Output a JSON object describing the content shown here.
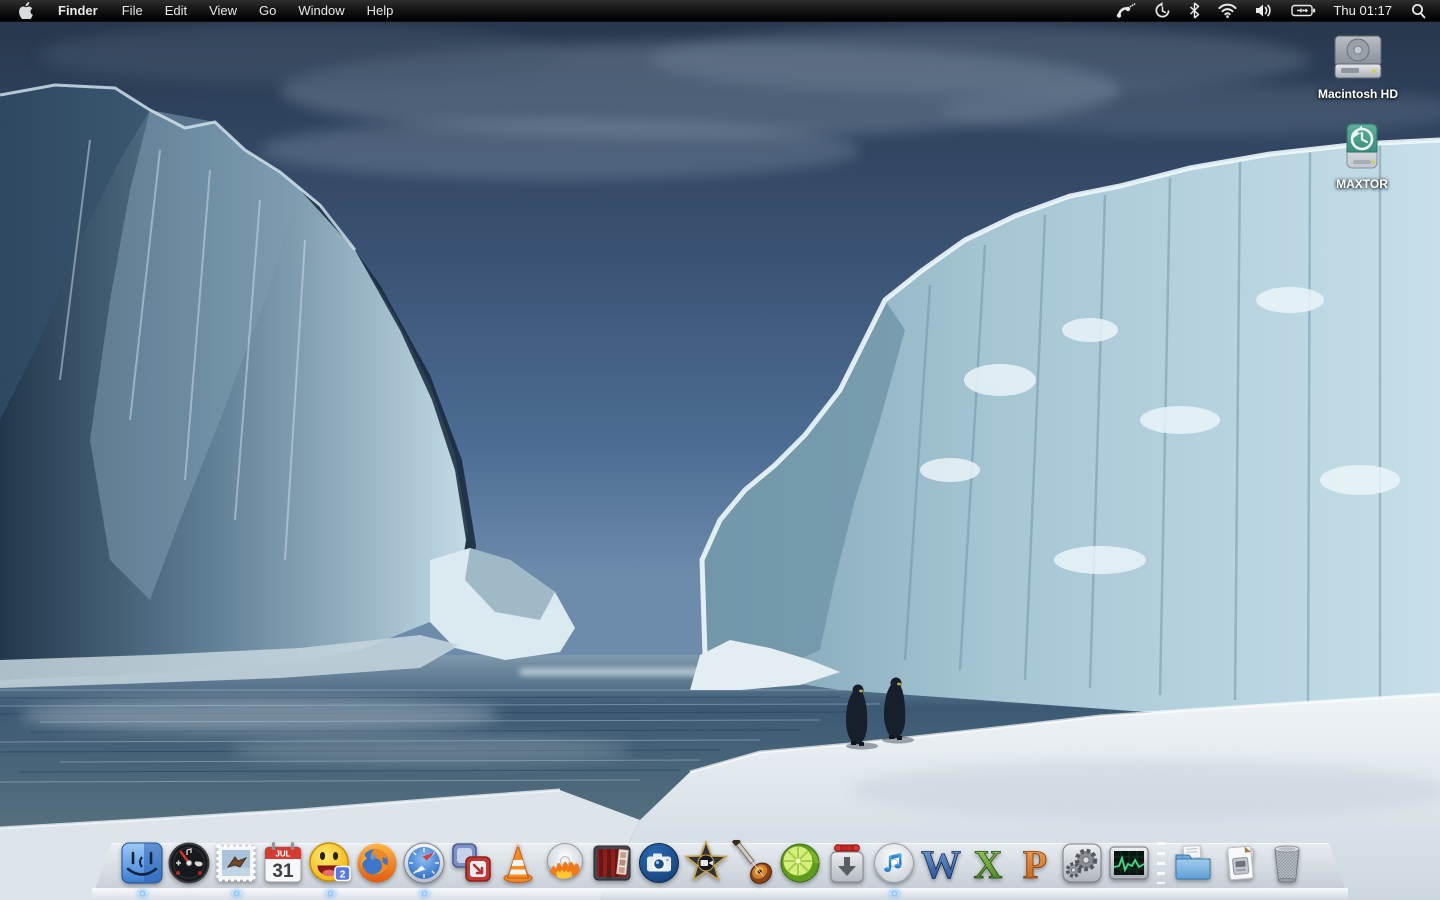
{
  "menu_bar": {
    "active_app": "Finder",
    "items": [
      "Finder",
      "File",
      "Edit",
      "View",
      "Go",
      "Window",
      "Help"
    ],
    "clock": "Thu 01:17",
    "status_icons": [
      "phone",
      "time-machine",
      "bluetooth",
      "wifi",
      "volume",
      "battery",
      "spotlight"
    ],
    "colors": {
      "bar_bg": "#000000",
      "text": "#e8e8e8"
    }
  },
  "desktop": {
    "volumes": [
      {
        "label": "Macintosh HD",
        "type": "internal-hard-drive"
      },
      {
        "label": "MAXTOR",
        "type": "external-time-machine-drive"
      }
    ],
    "wallpaper": {
      "subject": "iceberg canyon with two emperor penguins",
      "colors": {
        "sky_top": "#26354a",
        "sky_mid": "#49688c",
        "ice_light": "#c2dae4",
        "ice_dark": "#1c3046",
        "water": "#3c5a74",
        "snow": "#e8edf1"
      }
    }
  },
  "dock": {
    "apps": [
      {
        "name": "Finder",
        "running": true
      },
      {
        "name": "Dashboard",
        "running": false
      },
      {
        "name": "Mail",
        "running": true
      },
      {
        "name": "iCal",
        "running": false
      },
      {
        "name": "Yahoo Messenger",
        "running": true
      },
      {
        "name": "Firefox",
        "running": false
      },
      {
        "name": "Safari",
        "running": true
      },
      {
        "name": "VMware Fusion",
        "running": false
      },
      {
        "name": "VLC",
        "running": false
      },
      {
        "name": "Burn",
        "running": false
      },
      {
        "name": "Photo Booth",
        "running": false
      },
      {
        "name": "Camera",
        "running": false
      },
      {
        "name": "iMovie",
        "running": false
      },
      {
        "name": "GarageBand",
        "running": false
      },
      {
        "name": "LimeWire",
        "running": false
      },
      {
        "name": "Transmission",
        "running": false
      },
      {
        "name": "iTunes",
        "running": true
      },
      {
        "name": "Microsoft Word",
        "running": false
      },
      {
        "name": "Microsoft Excel",
        "running": false
      },
      {
        "name": "Microsoft PowerPoint",
        "running": false
      },
      {
        "name": "System Preferences",
        "running": false
      },
      {
        "name": "Activity Monitor",
        "running": false
      }
    ],
    "folders": [
      {
        "name": "Documents"
      },
      {
        "name": "Downloads Stack"
      },
      {
        "name": "Trash"
      }
    ],
    "ical": {
      "month": "JUL",
      "day": "31"
    },
    "yahoo_badge": "2",
    "office_letters": {
      "word": "W",
      "excel": "X",
      "powerpoint": "P"
    }
  }
}
